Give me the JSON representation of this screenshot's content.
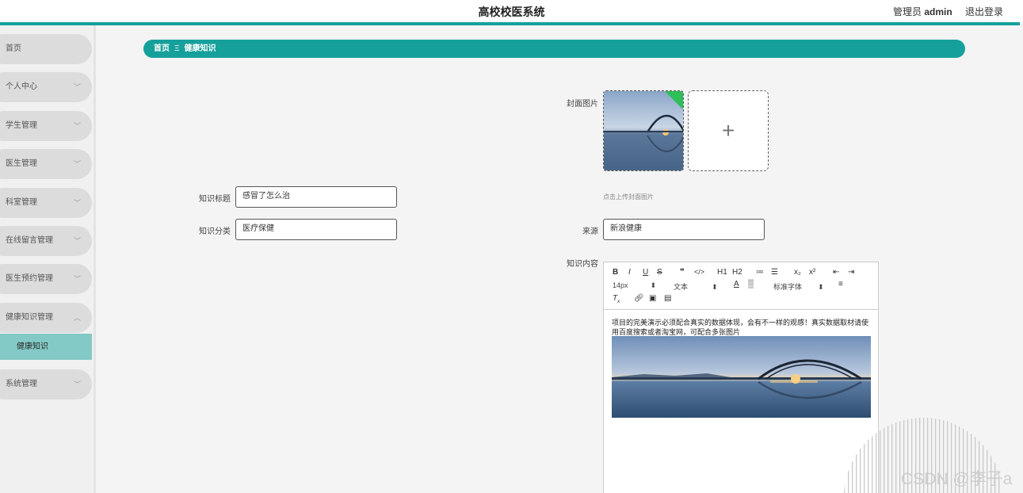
{
  "header": {
    "title": "高校校医系统",
    "admin_prefix": "管理员",
    "admin_name": "admin",
    "logout": "退出登录"
  },
  "sidebar": {
    "items": [
      {
        "label": "首页",
        "has_arrow": false
      },
      {
        "label": "个人中心",
        "has_arrow": true
      },
      {
        "label": "学生管理",
        "has_arrow": true
      },
      {
        "label": "医生管理",
        "has_arrow": true
      },
      {
        "label": "科室管理",
        "has_arrow": true
      },
      {
        "label": "在线留言管理",
        "has_arrow": true
      },
      {
        "label": "医生预约管理",
        "has_arrow": true
      },
      {
        "label": "健康知识管理",
        "has_arrow": true,
        "expanded": true
      },
      {
        "label": "系统管理",
        "has_arrow": true
      }
    ],
    "active_sub": "健康知识"
  },
  "breadcrumb": {
    "home": "首页",
    "sep": "Ξ",
    "current": "健康知识"
  },
  "form": {
    "cover_label": "封面图片",
    "cover_hint": "点击上传封面图片",
    "title_label": "知识标题",
    "title_value": "感冒了怎么治",
    "category_label": "知识分类",
    "category_value": "医疗保健",
    "source_label": "来源",
    "source_value": "新浪健康",
    "content_label": "知识内容"
  },
  "editor": {
    "toolbar_row1": [
      "B",
      "I",
      "U",
      "S",
      "❞",
      "</>",
      "H1",
      "H2",
      "≔",
      "☰",
      "x₂",
      "x²",
      "⇤",
      "⇥"
    ],
    "size_value": "14px",
    "format_value": "文本",
    "font_value": "标准字体",
    "content_text": "项目的完美演示必须配合真实的数据体现，会有不一样的观感！真实数据取材请使用百度搜索或者淘宝网，可配合多张图片"
  },
  "watermark": "CSDN @李子a",
  "colors": {
    "accent": "#16a09b",
    "active_sub": "#83c9c5"
  }
}
